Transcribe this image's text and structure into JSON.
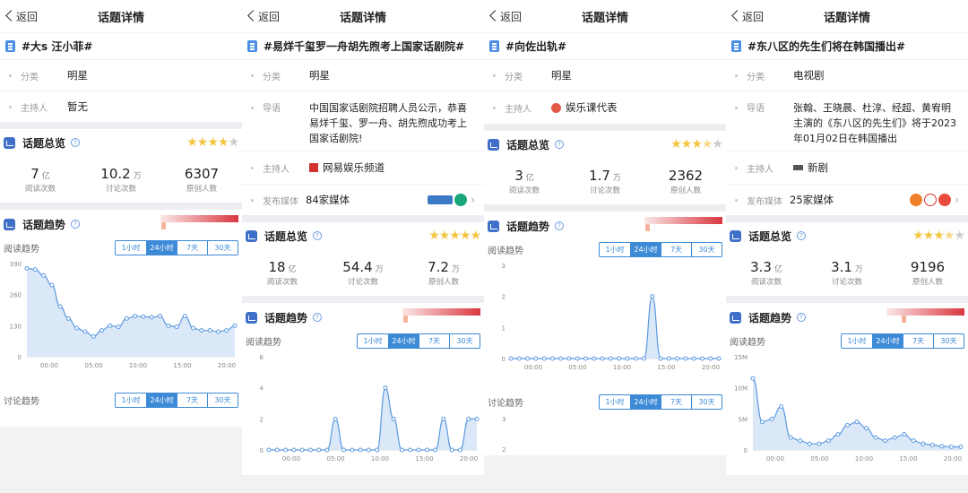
{
  "nav": {
    "back": "返回",
    "title": "话题详情"
  },
  "labels": {
    "category": "分类",
    "host": "主持人",
    "lead": "导语",
    "media": "发布媒体",
    "overview": "话题总览",
    "trend": "话题趋势",
    "read_trend": "阅读趋势",
    "discuss_trend": "讨论趋势",
    "read": "阅读次数",
    "discuss": "讨论次数",
    "original": "原创人数",
    "ranges": [
      "1小时",
      "24小时",
      "7天",
      "30天"
    ],
    "active_range": "24小时",
    "x_ticks": [
      "00:00",
      "05:00",
      "10:00",
      "15:00",
      "20:00"
    ]
  },
  "colors": {
    "accent": "#3d8ad6",
    "star": "#f4c542",
    "heat": "#d9363e"
  },
  "panels": [
    {
      "topic": "#大s 汪小菲#",
      "category": "明星",
      "host": "暂无",
      "rating": 4,
      "stats": {
        "read": "7",
        "read_unit": "亿",
        "discuss": "10.2",
        "discuss_unit": "万",
        "original": "6307"
      },
      "read_chart": {
        "y_ticks": [
          "390",
          "260",
          "130",
          "0"
        ],
        "ymax": 390,
        "values": [
          370,
          365,
          340,
          300,
          210,
          160,
          120,
          105,
          85,
          110,
          130,
          125,
          160,
          170,
          168,
          165,
          170,
          130,
          125,
          170,
          120,
          110,
          110,
          105,
          110,
          130
        ]
      },
      "discuss_chart": {
        "values": []
      }
    },
    {
      "topic": "#易烊千玺罗一舟胡先煦考上国家话剧院#",
      "category": "明星",
      "lead": "中国国家话剧院招聘人员公示，恭喜易烊千玺、罗一舟、胡先煦成功考上国家话剧院!",
      "host": "网易娱乐频道",
      "media": "84家媒体",
      "rating": 5,
      "stats": {
        "read": "18",
        "read_unit": "亿",
        "discuss": "54.4",
        "discuss_unit": "万",
        "original": "7.2",
        "original_unit": "万"
      },
      "read_chart": {
        "y_ticks": [
          "6",
          "4",
          "2",
          "0"
        ],
        "ymax": 6,
        "values": [
          0,
          0,
          0,
          0,
          0,
          0,
          0,
          0,
          2,
          0,
          0,
          0,
          0,
          0,
          4,
          2,
          0,
          0,
          0,
          0,
          0,
          2,
          0,
          0,
          2,
          2
        ]
      }
    },
    {
      "topic": "#向佐出轨#",
      "category": "明星",
      "host": "娱乐课代表",
      "rating": 3.5,
      "stats": {
        "read": "3",
        "read_unit": "亿",
        "discuss": "1.7",
        "discuss_unit": "万",
        "original": "2362"
      },
      "read_chart": {
        "y_ticks": [
          "3",
          "2",
          "1",
          "0"
        ],
        "ymax": 3,
        "values": [
          0,
          0,
          0,
          0,
          0,
          0,
          0,
          0,
          0,
          0,
          0,
          0,
          0,
          0,
          0,
          0,
          0,
          2,
          0,
          0,
          0,
          0,
          0,
          0,
          0,
          0
        ]
      },
      "discuss_chart": {
        "y_ticks": [
          "3",
          "2"
        ]
      }
    },
    {
      "topic": "#东八区的先生们将在韩国播出#",
      "category": "电视剧",
      "lead": "张翰、王晓晨、杜淳、经超、黄宥明主演的《东八区的先生们》将于2023年01月02日在韩国播出",
      "host": "新剧",
      "media": "25家媒体",
      "rating": 3.5,
      "stats": {
        "read": "3.3",
        "read_unit": "亿",
        "discuss": "3.1",
        "discuss_unit": "万",
        "original": "9196"
      },
      "read_chart": {
        "y_ticks": [
          "15M",
          "10M",
          "5M",
          "0"
        ],
        "ymax": 15,
        "values": [
          11.5,
          4.5,
          5,
          7,
          2,
          1.5,
          1,
          1,
          1.5,
          2.5,
          4,
          4.5,
          3.5,
          2,
          1.5,
          2,
          2.5,
          1.5,
          1,
          0.8,
          0.6,
          0.5,
          0.5
        ]
      }
    }
  ]
}
